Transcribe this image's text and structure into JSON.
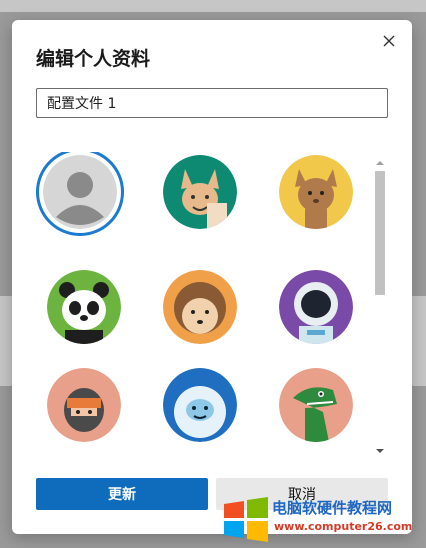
{
  "dialog": {
    "title": "编辑个人资料",
    "profile_name_value": "配置文件 1"
  },
  "avatars": [
    {
      "name": "default-person",
      "bg": "#d6d6d6",
      "selected": true
    },
    {
      "name": "fox",
      "bg": "#0e8a72",
      "selected": false
    },
    {
      "name": "cat",
      "bg": "#f2c84b",
      "selected": false
    },
    {
      "name": "panda",
      "bg": "#6cb33f",
      "selected": false
    },
    {
      "name": "hedgehog",
      "bg": "#f0a048",
      "selected": false
    },
    {
      "name": "astronaut",
      "bg": "#7a4aa8",
      "selected": false
    },
    {
      "name": "ninja",
      "bg": "#e8a08a",
      "selected": false
    },
    {
      "name": "yeti",
      "bg": "#1f6ec0",
      "selected": false
    },
    {
      "name": "dinosaur",
      "bg": "#e8a08a",
      "selected": false
    },
    {
      "name": "partial-teal",
      "bg": "#178a7a",
      "selected": false
    },
    {
      "name": "partial-yellow",
      "bg": "#f2c84b",
      "selected": false
    },
    {
      "name": "partial-cyan",
      "bg": "#4cc6d8",
      "selected": false
    }
  ],
  "buttons": {
    "update_label": "更新",
    "cancel_label": "取消"
  },
  "watermark": {
    "line1": "电脑软硬件教程网",
    "line2": "www.computer26.com",
    "colors": [
      "#f25022",
      "#7fba00",
      "#00a4ef",
      "#ffb900"
    ]
  }
}
